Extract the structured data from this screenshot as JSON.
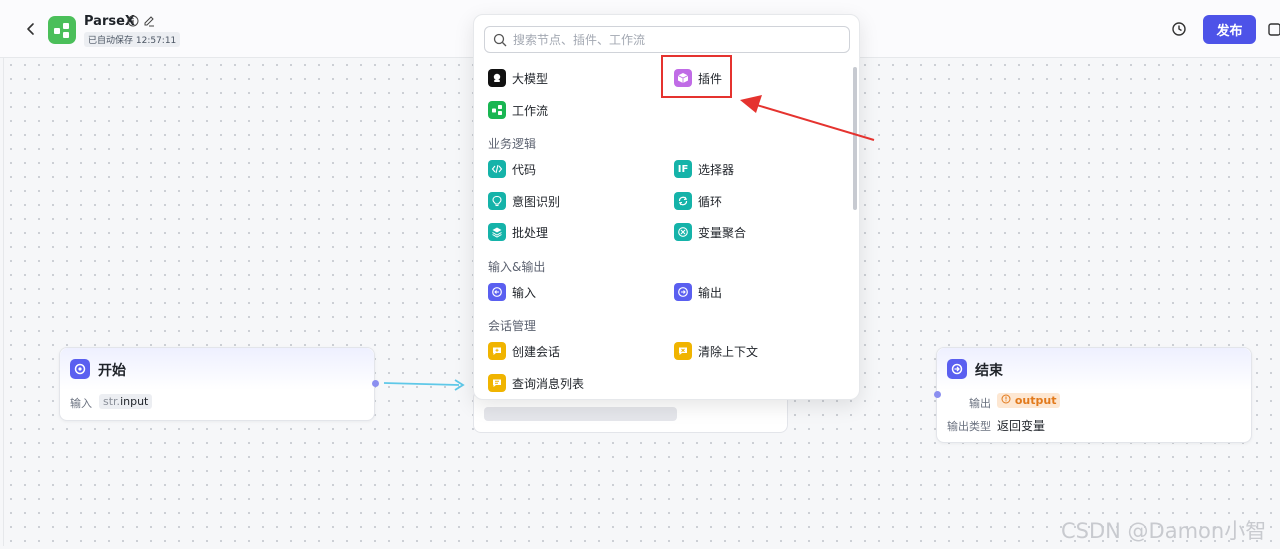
{
  "header": {
    "app_name": "ParseX",
    "save_status": "已自动保存 12:57:11",
    "publish_label": "发布"
  },
  "popup": {
    "search_placeholder": "搜索节点、插件、工作流",
    "top_items": [
      {
        "label": "大模型",
        "icon": "llm-icon",
        "color": "#111111"
      },
      {
        "label": "插件",
        "icon": "plugin-cube-icon",
        "color": "#c06be6"
      },
      {
        "label": "工作流",
        "icon": "workflow-icon",
        "color": "#19b652"
      }
    ],
    "sections": [
      {
        "title": "业务逻辑",
        "items": [
          {
            "label": "代码",
            "icon": "code-icon",
            "color": "#15b3a9"
          },
          {
            "label": "选择器",
            "icon": "if-icon",
            "color": "#15b3a9",
            "glyph": "IF"
          },
          {
            "label": "意图识别",
            "icon": "intent-icon",
            "color": "#15b3a9"
          },
          {
            "label": "循环",
            "icon": "loop-icon",
            "color": "#15b3a9"
          },
          {
            "label": "批处理",
            "icon": "batch-icon",
            "color": "#15b3a9"
          },
          {
            "label": "变量聚合",
            "icon": "variable-merge-icon",
            "color": "#15b3a9"
          }
        ]
      },
      {
        "title": "输入&输出",
        "items": [
          {
            "label": "输入",
            "icon": "input-icon",
            "color": "#5a5ff0"
          },
          {
            "label": "输出",
            "icon": "output-icon",
            "color": "#5a5ff0"
          }
        ]
      },
      {
        "title": "会话管理",
        "items": [
          {
            "label": "创建会话",
            "icon": "create-chat-icon",
            "color": "#f0b400"
          },
          {
            "label": "清除上下文",
            "icon": "clear-context-icon",
            "color": "#f0b400"
          },
          {
            "label": "查询消息列表",
            "icon": "message-list-icon",
            "color": "#f0b400"
          }
        ]
      }
    ]
  },
  "start_node": {
    "title": "开始",
    "input_label": "输入",
    "param_prefix": "str.",
    "param_name": "input"
  },
  "end_node": {
    "title": "结束",
    "output_label": "输出",
    "output_var": "output",
    "output_type_label": "输出类型",
    "output_type_value": "返回变量"
  },
  "watermark": "CSDN @Damon小智",
  "colors": {
    "accent": "#4d53e8",
    "annotation_red": "#e5332f",
    "connector": "#5ec8e8"
  }
}
